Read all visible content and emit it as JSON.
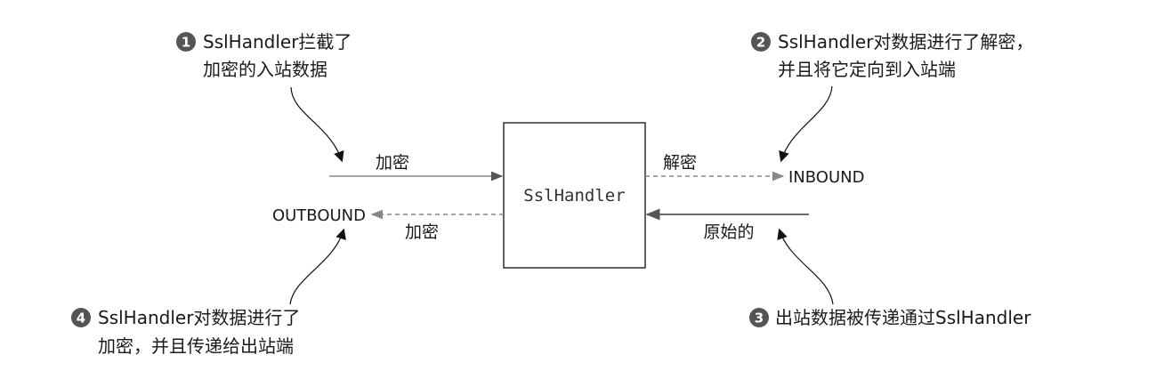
{
  "box": {
    "label": "SslHandler"
  },
  "ports": {
    "inbound": "INBOUND",
    "outbound": "OUTBOUND"
  },
  "edges": {
    "in_encrypted": "加密",
    "in_decrypted": "解密",
    "out_encrypted": "加密",
    "out_original": "原始的"
  },
  "callouts": [
    {
      "number": "1",
      "lines": [
        "SslHandler拦截了",
        "加密的入站数据"
      ]
    },
    {
      "number": "2",
      "lines": [
        "SslHandler对数据进行了解密，",
        "并且将它定向到入站端"
      ]
    },
    {
      "number": "3",
      "lines": [
        "出站数据被传递通过SslHandler"
      ]
    },
    {
      "number": "4",
      "lines": [
        "SslHandler对数据进行了",
        "加密，并且传递给出站端"
      ]
    }
  ],
  "colors": {
    "solid_arrow": "#555555",
    "dashed_arrow": "#888888",
    "badge": "#555555",
    "box_border": "#222222"
  }
}
